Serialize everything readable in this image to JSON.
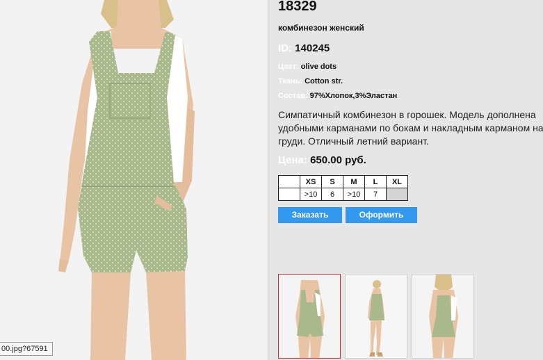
{
  "product": {
    "article": "18329",
    "subtitle": "комбинезон женский",
    "id_label": "ID:",
    "id_value": "140245",
    "color_label": "Цвет:",
    "color_value": "olive dots",
    "fabric_label": "Ткань:",
    "fabric_value": "Cotton str.",
    "composition_label": "Состав:",
    "composition_value": "97%Хлопок,3%Эластан",
    "description": "Симпатичный комбинезон  в горошек. Модель дополнена удобными карманами по бокам и накладным карманом на груди. Отличный летний вариант.",
    "price_label": "Цена:",
    "price_value": "650.00 руб."
  },
  "sizes": {
    "headers": [
      "XS",
      "S",
      "M",
      "L",
      "XL"
    ],
    "stock": [
      ">10",
      "6",
      ">10",
      "7",
      ""
    ]
  },
  "actions": {
    "order_label": "Заказать",
    "checkout_label": "Оформить"
  },
  "status_bar": {
    "url_fragment": "00.jpg?67591"
  },
  "colors": {
    "accent": "#3399ee",
    "background": "#e6e6e6",
    "garment": "#a9b98c",
    "thumb_selected_border": "#c93030"
  }
}
